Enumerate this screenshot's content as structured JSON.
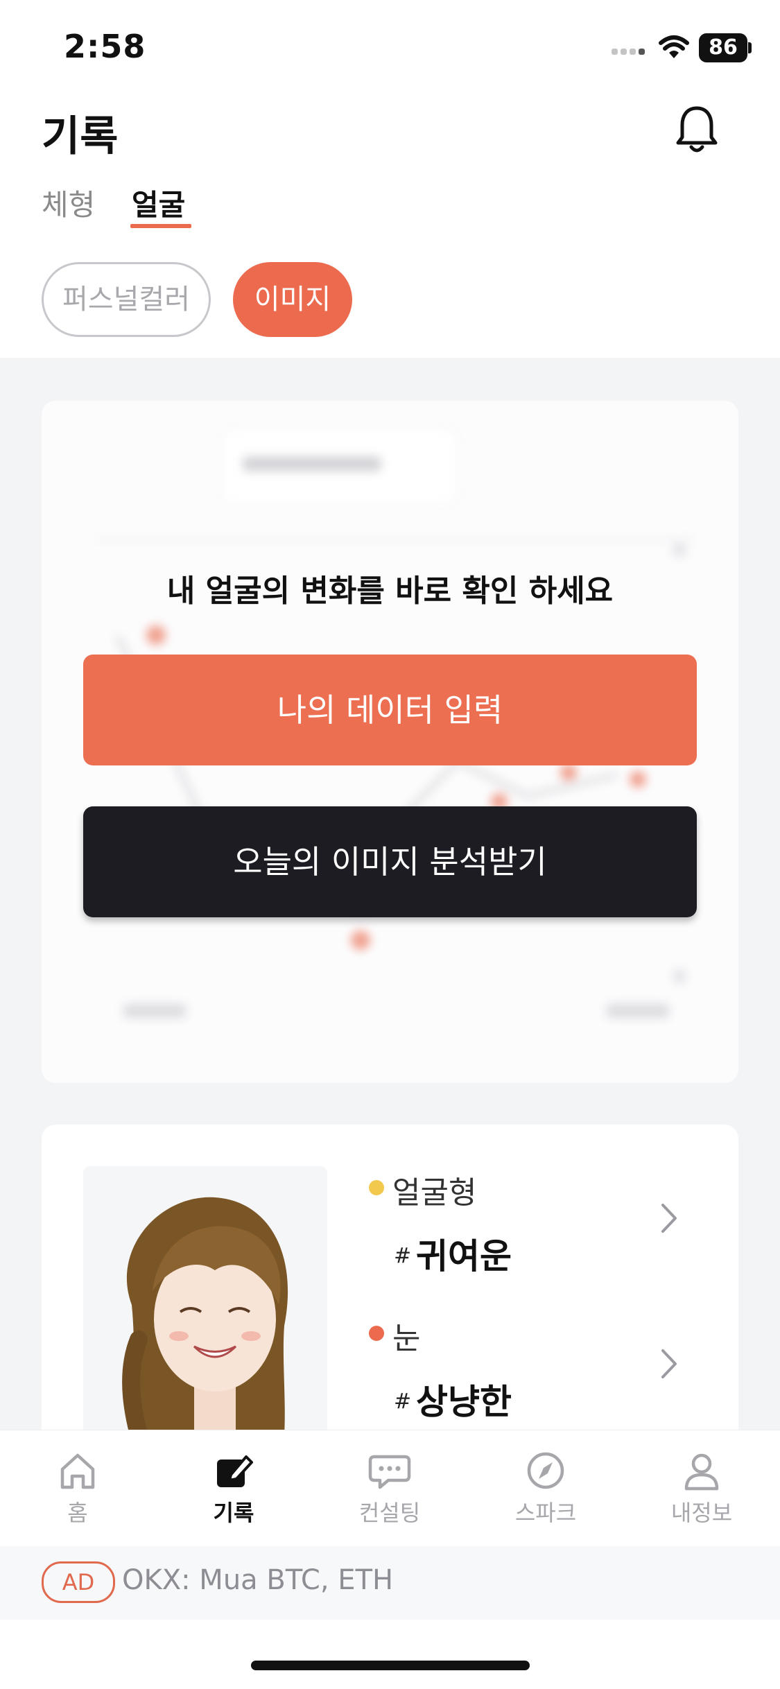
{
  "status_bar": {
    "time": "2:58",
    "battery": "86"
  },
  "header": {
    "title": "기록"
  },
  "tabs": [
    {
      "label": "체형"
    },
    {
      "label": "얼굴"
    }
  ],
  "chips": [
    {
      "label": "퍼스널컬러"
    },
    {
      "label": "이미지"
    }
  ],
  "chart_card": {
    "headline": "내 얼굴의 변화를 바로 확인 하세요",
    "input_button": "나의 데이터 입력",
    "analyze_button": "오늘의 이미지 분석받기"
  },
  "profile": {
    "items": [
      {
        "label": "얼굴형",
        "value": "귀여운"
      },
      {
        "label": "눈",
        "value": "상냥한"
      }
    ],
    "hash": "#"
  },
  "nav": [
    {
      "label": "홈",
      "icon": "home-icon"
    },
    {
      "label": "기록",
      "icon": "edit-icon"
    },
    {
      "label": "컨설팅",
      "icon": "chat-icon"
    },
    {
      "label": "스파크",
      "icon": "compass-icon"
    },
    {
      "label": "내정보",
      "icon": "user-icon"
    }
  ],
  "ad": {
    "badge": "AD",
    "text": "OKX: Mua BTC, ETH"
  },
  "colors": {
    "accent": "#ec6b4f",
    "dark_button": "#1c1c22",
    "background_gray": "#f3f4f6"
  }
}
